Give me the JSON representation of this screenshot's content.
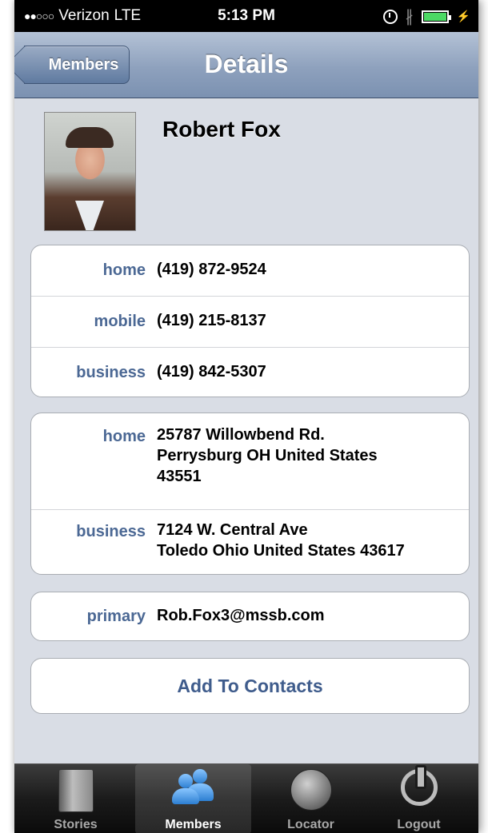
{
  "status_bar": {
    "signal": "●●○○○",
    "carrier": "Verizon",
    "network": "LTE",
    "time": "5:13 PM"
  },
  "nav": {
    "back_label": "Members",
    "title": "Details"
  },
  "profile": {
    "name": "Robert Fox"
  },
  "phones": [
    {
      "label": "home",
      "value": "(419) 872-9524"
    },
    {
      "label": "mobile",
      "value": "(419) 215-8137"
    },
    {
      "label": "business",
      "value": "(419) 842-5307"
    }
  ],
  "addresses": [
    {
      "label": "home",
      "lines": [
        "25787 Willowbend Rd.",
        "Perrysburg OH United States",
        "43551"
      ]
    },
    {
      "label": "business",
      "lines": [
        "7124 W. Central Ave",
        "Toledo Ohio United States 43617"
      ]
    }
  ],
  "email": {
    "label": "primary",
    "value": "Rob.Fox3@mssb.com"
  },
  "add_button": "Add To Contacts",
  "tabs": [
    {
      "label": "Stories",
      "icon": "book-icon",
      "active": false
    },
    {
      "label": "Members",
      "icon": "people-icon",
      "active": true
    },
    {
      "label": "Locator",
      "icon": "globe-icon",
      "active": false
    },
    {
      "label": "Logout",
      "icon": "power-icon",
      "active": false
    }
  ],
  "colors": {
    "label_blue": "#4b6894",
    "button_blue": "#3f5c8c",
    "nav_blue": "#8ea1bd"
  }
}
